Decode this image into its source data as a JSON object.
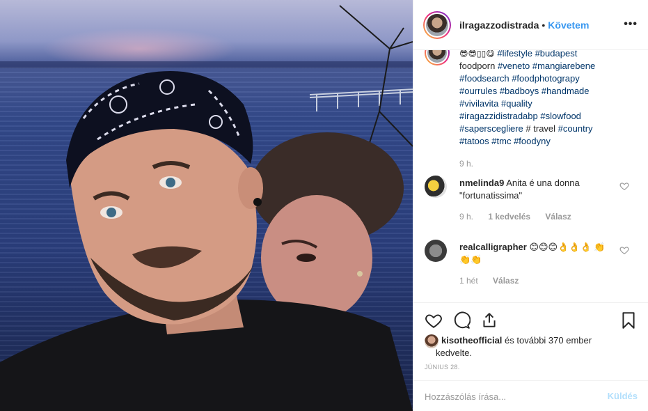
{
  "post": {
    "username": "ilragazzodistrada",
    "separator": "•",
    "follow_label": "Követem",
    "more_label": "•••"
  },
  "caption": {
    "emojis": "😎😎▯▯😋",
    "line1_tags": [
      "#lifestyle",
      "#budapest"
    ],
    "word_foodporn": "foodporn",
    "line2_tags": [
      "#veneto",
      "#mangiarebene"
    ],
    "line3_tags": [
      "#foodsearch",
      "#foodphotograpy"
    ],
    "line4_tags": [
      "#ourrules",
      "#badboys",
      "#handmade"
    ],
    "line5_tags": [
      "#vivilavita",
      "#quality"
    ],
    "line6_tags": [
      "#iragazzidistradabp",
      "#slowfood"
    ],
    "line7_tag": "#saperscegliere",
    "line7_plain": "# travel",
    "line7_tag2": "#country",
    "line8_tags": [
      "#tatoos",
      "#tmc",
      "#foodyny"
    ],
    "time": "9 h."
  },
  "comments": [
    {
      "user": "nmelinda9",
      "text": "Anita é una donna \"fortunatissima\"",
      "time": "9 h.",
      "likes": "1 kedvelés",
      "reply": "Válasz"
    },
    {
      "user": "realcalligrapher",
      "text": "😊😊😊👌👌👌 👏👏👏",
      "time": "1 hét",
      "reply": "Válasz"
    }
  ],
  "likes": {
    "user": "kisotheofficial",
    "rest": "és további 370 ember kedvelte."
  },
  "date": "JÚNIUS 28.",
  "add_comment": {
    "placeholder": "Hozzászólás írása...",
    "send_label": "Küldés"
  },
  "icons": {
    "like": "heart-icon",
    "comment": "comment-icon",
    "share": "share-icon",
    "save": "bookmark-icon",
    "more": "more-icon"
  },
  "colors": {
    "link": "#003569",
    "follow": "#3897f0",
    "muted": "#999999",
    "send_disabled": "#b2dffc"
  }
}
